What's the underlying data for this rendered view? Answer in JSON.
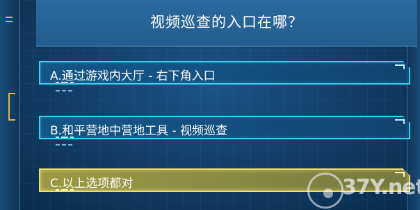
{
  "quiz": {
    "question": "视频巡查的入口在哪？",
    "options": [
      {
        "label": "A.通过游戏内大厅 - 右下角入口",
        "selected": false
      },
      {
        "label": "B.和平营地中营地工具 - 视频巡查",
        "selected": false
      },
      {
        "label": "C.以上选项都对",
        "selected": true
      }
    ]
  },
  "watermark": {
    "text": "37Y.net",
    "icon": "37y-logo-icon"
  },
  "colors": {
    "panel": "#2a6a9e",
    "option_border": "#3ad0f0",
    "selected_fill": "#b4aa3c",
    "selected_border": "#f0de6a",
    "accent": "#e2b43c"
  }
}
